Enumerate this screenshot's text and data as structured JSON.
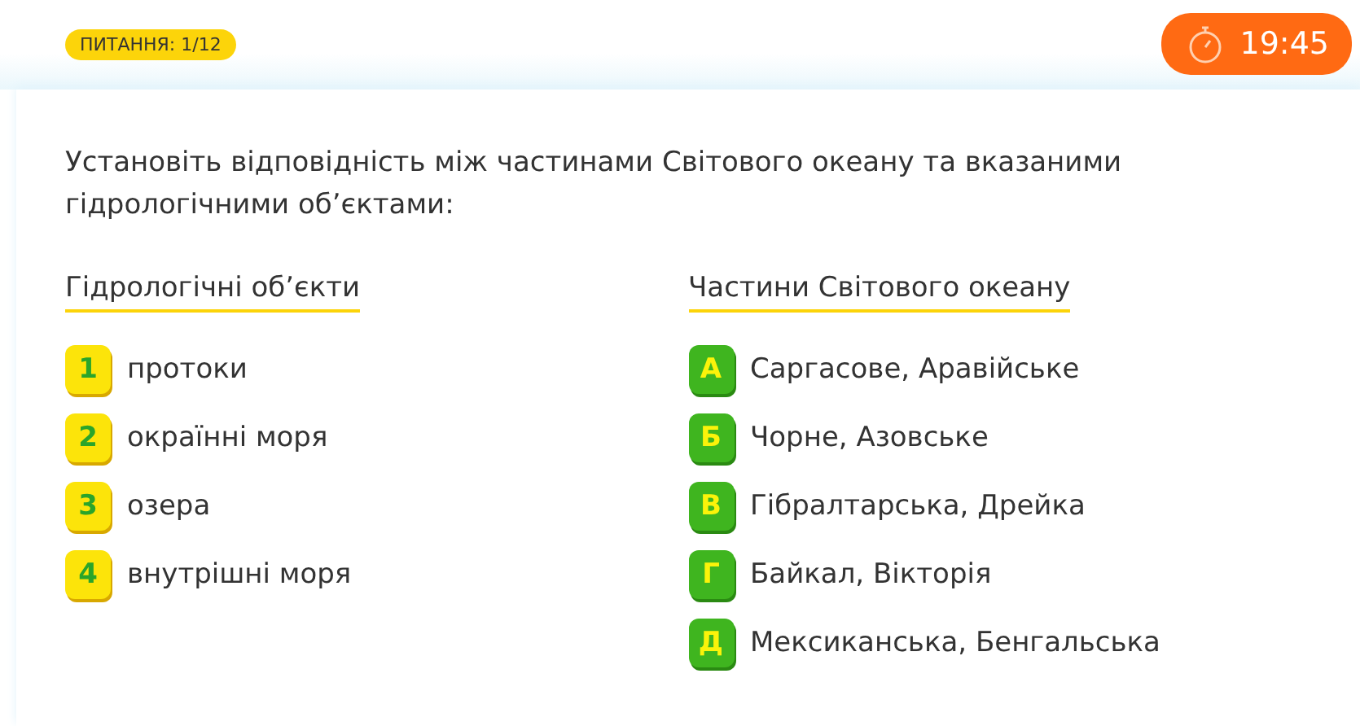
{
  "question_badge": "ПИТАННЯ: 1/12",
  "timer": "19:45",
  "question": "Установіть відповідність між частинами Світового океану та вказаними гідрологічними об’єктами:",
  "columns": [
    {
      "heading": "Гідрологічні об’єкти",
      "kind": "numbers",
      "items": [
        {
          "key": "1",
          "text": "протоки"
        },
        {
          "key": "2",
          "text": "окраїнні моря"
        },
        {
          "key": "3",
          "text": "озера"
        },
        {
          "key": "4",
          "text": "внутрішні моря"
        }
      ]
    },
    {
      "heading": "Частини Світового океану",
      "kind": "letters",
      "items": [
        {
          "key": "А",
          "text": "Саргасове, Аравійське"
        },
        {
          "key": "Б",
          "text": "Чорне, Азовське"
        },
        {
          "key": "В",
          "text": "Гібралтарська, Дрейка"
        },
        {
          "key": "Г",
          "text": "Байкал, Вікторія"
        },
        {
          "key": "Д",
          "text": "Мексиканська, Бенгальська"
        }
      ]
    }
  ]
}
